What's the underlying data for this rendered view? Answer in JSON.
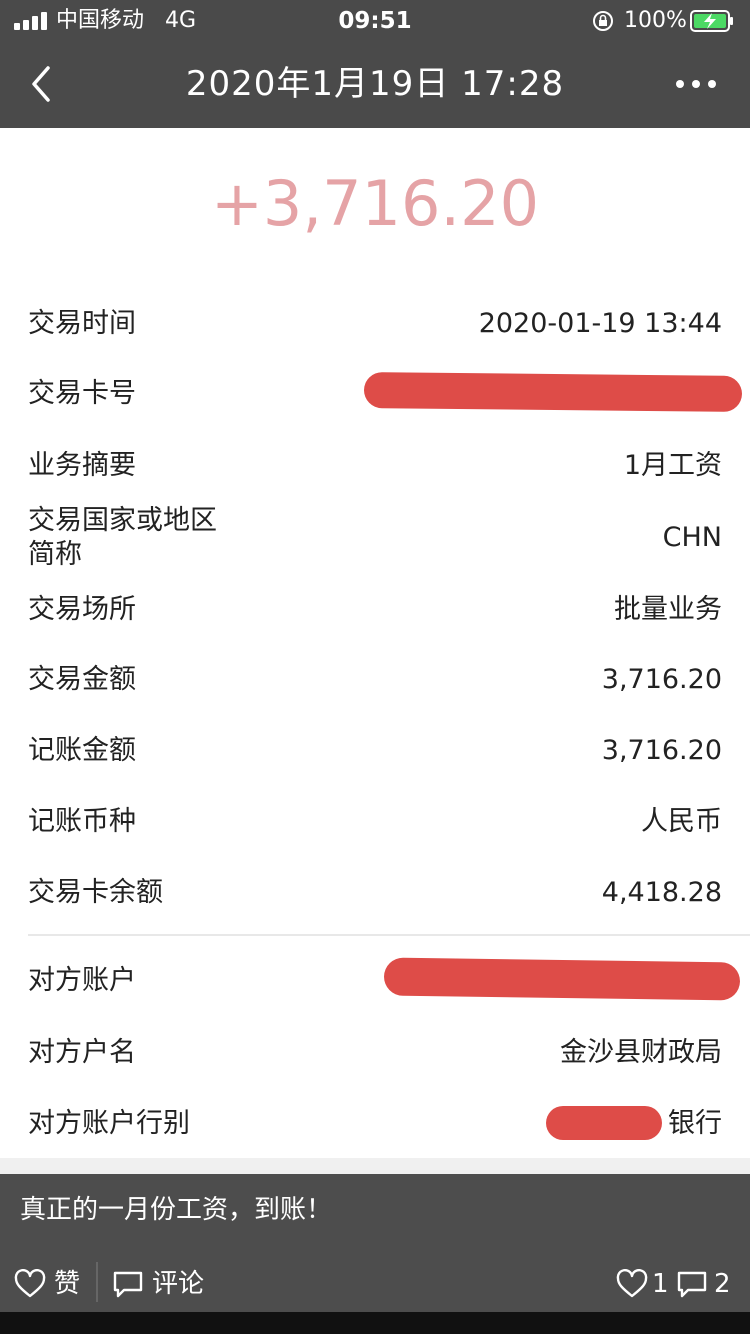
{
  "status_bar": {
    "carrier": "中国移动",
    "network": "4G",
    "time": "09:51",
    "battery_percent": "100%"
  },
  "title_bar": {
    "title": "2020年1月19日 17:28"
  },
  "amount": "+3,716.20",
  "details": [
    {
      "label": "交易时间",
      "value": "2020-01-19 13:44"
    },
    {
      "label": "交易卡号",
      "value": ""
    },
    {
      "label": "业务摘要",
      "value": "1月工资"
    },
    {
      "label_line1": "交易国家或地区",
      "label_line2": "简称",
      "value": "CHN"
    },
    {
      "label": "交易场所",
      "value": "批量业务"
    },
    {
      "label": "交易金额",
      "value": "3,716.20"
    },
    {
      "label": "记账金额",
      "value": "3,716.20"
    },
    {
      "label": "记账币种",
      "value": "人民币"
    },
    {
      "label": "交易卡余额",
      "value": "4,418.28"
    }
  ],
  "counterparty": [
    {
      "label": "对方账户",
      "value": ""
    },
    {
      "label": "对方户名",
      "value": "金沙县财政局"
    },
    {
      "label": "对方账户行别",
      "value": "银行"
    }
  ],
  "post": {
    "caption": "真正的一月份工资，到账！",
    "like_label": "赞",
    "comment_label": "评论",
    "like_count": "1",
    "comment_count": "2"
  },
  "colors": {
    "amount": "#e5a3a6",
    "redaction": "#de4c48",
    "bar": "#4a4a4a"
  },
  "icons": [
    "signal-icon",
    "lock-rotation-icon",
    "battery-charging-icon",
    "back-chevron-icon",
    "more-icon",
    "heart-icon",
    "comment-icon"
  ]
}
